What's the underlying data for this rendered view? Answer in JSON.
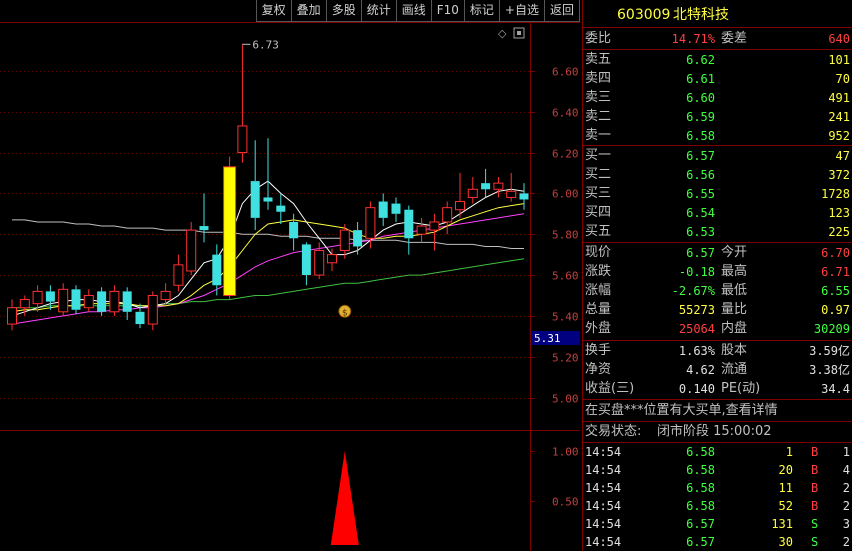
{
  "toolbar": {
    "buttons": [
      "复权",
      "叠加",
      "多股",
      "统计",
      "画线",
      "F10",
      "标记",
      "+自选",
      "返回"
    ]
  },
  "chart": {
    "high_marker": "6.73",
    "price_axis_labels": [
      "6.60",
      "6.40",
      "6.20",
      "6.00",
      "5.80",
      "5.60",
      "5.40",
      "5.20",
      "5.00"
    ],
    "current_price_tag": "5.31",
    "volume_axis_labels": [
      "1.00",
      "0.50"
    ],
    "colors": {
      "up": "#ff3030",
      "down": "#40e0e0",
      "ma5": "#ffffff",
      "ma10": "#ffff40",
      "ma20": "#ff40ff",
      "ma60": "#40c040",
      "long": "#c0c0c0"
    }
  },
  "chart_data": {
    "type": "candlestick",
    "ylim": [
      4.9,
      6.8
    ],
    "yticks": [
      5.0,
      5.2,
      5.4,
      5.6,
      5.8,
      6.0,
      6.2,
      6.4,
      6.6
    ],
    "candles": [
      {
        "o": 5.36,
        "c": 5.44,
        "h": 5.48,
        "l": 5.33
      },
      {
        "o": 5.44,
        "c": 5.48,
        "h": 5.5,
        "l": 5.4
      },
      {
        "o": 5.46,
        "c": 5.52,
        "h": 5.55,
        "l": 5.42
      },
      {
        "o": 5.52,
        "c": 5.47,
        "h": 5.55,
        "l": 5.43
      },
      {
        "o": 5.42,
        "c": 5.53,
        "h": 5.56,
        "l": 5.4
      },
      {
        "o": 5.53,
        "c": 5.43,
        "h": 5.55,
        "l": 5.41
      },
      {
        "o": 5.44,
        "c": 5.5,
        "h": 5.53,
        "l": 5.42
      },
      {
        "o": 5.52,
        "c": 5.42,
        "h": 5.54,
        "l": 5.4
      },
      {
        "o": 5.42,
        "c": 5.52,
        "h": 5.55,
        "l": 5.4
      },
      {
        "o": 5.52,
        "c": 5.42,
        "h": 5.54,
        "l": 5.38
      },
      {
        "o": 5.42,
        "c": 5.36,
        "h": 5.46,
        "l": 5.34
      },
      {
        "o": 5.36,
        "c": 5.5,
        "h": 5.52,
        "l": 5.33
      },
      {
        "o": 5.48,
        "c": 5.52,
        "h": 5.56,
        "l": 5.45
      },
      {
        "o": 5.55,
        "c": 5.65,
        "h": 5.7,
        "l": 5.52
      },
      {
        "o": 5.62,
        "c": 5.82,
        "h": 5.86,
        "l": 5.6
      },
      {
        "o": 5.84,
        "c": 5.82,
        "h": 6.0,
        "l": 5.76
      },
      {
        "o": 5.7,
        "c": 5.55,
        "h": 5.75,
        "l": 5.5
      },
      {
        "o": 5.5,
        "c": 6.13,
        "h": 6.18,
        "l": 5.48
      },
      {
        "o": 6.2,
        "c": 6.33,
        "h": 6.73,
        "l": 6.15
      },
      {
        "o": 6.06,
        "c": 5.88,
        "h": 6.26,
        "l": 5.82
      },
      {
        "o": 5.98,
        "c": 5.96,
        "h": 6.27,
        "l": 5.92
      },
      {
        "o": 5.94,
        "c": 5.91,
        "h": 6.0,
        "l": 5.85
      },
      {
        "o": 5.86,
        "c": 5.78,
        "h": 5.9,
        "l": 5.72
      },
      {
        "o": 5.75,
        "c": 5.6,
        "h": 5.76,
        "l": 5.55
      },
      {
        "o": 5.6,
        "c": 5.72,
        "h": 5.76,
        "l": 5.58
      },
      {
        "o": 5.66,
        "c": 5.7,
        "h": 5.73,
        "l": 5.62
      },
      {
        "o": 5.72,
        "c": 5.82,
        "h": 5.85,
        "l": 5.68
      },
      {
        "o": 5.82,
        "c": 5.74,
        "h": 5.86,
        "l": 5.7
      },
      {
        "o": 5.78,
        "c": 5.93,
        "h": 5.96,
        "l": 5.73
      },
      {
        "o": 5.96,
        "c": 5.88,
        "h": 6.0,
        "l": 5.84
      },
      {
        "o": 5.95,
        "c": 5.9,
        "h": 5.98,
        "l": 5.86
      },
      {
        "o": 5.92,
        "c": 5.78,
        "h": 5.94,
        "l": 5.7
      },
      {
        "o": 5.8,
        "c": 5.84,
        "h": 5.88,
        "l": 5.76
      },
      {
        "o": 5.82,
        "c": 5.86,
        "h": 5.9,
        "l": 5.72
      },
      {
        "o": 5.86,
        "c": 5.93,
        "h": 5.96,
        "l": 5.8
      },
      {
        "o": 5.92,
        "c": 5.96,
        "h": 6.1,
        "l": 5.88
      },
      {
        "o": 5.98,
        "c": 6.02,
        "h": 6.08,
        "l": 5.95
      },
      {
        "o": 6.05,
        "c": 6.02,
        "h": 6.12,
        "l": 5.98
      },
      {
        "o": 6.02,
        "c": 6.05,
        "h": 6.08,
        "l": 5.98
      },
      {
        "o": 5.98,
        "c": 6.01,
        "h": 6.1,
        "l": 5.96
      },
      {
        "o": 6.0,
        "c": 5.97,
        "h": 6.05,
        "l": 5.92
      }
    ],
    "ma5": [
      5.4,
      5.42,
      5.44,
      5.46,
      5.47,
      5.48,
      5.48,
      5.47,
      5.47,
      5.46,
      5.44,
      5.45,
      5.46,
      5.5,
      5.58,
      5.66,
      5.68,
      5.78,
      5.95,
      6.02,
      6.06,
      6.0,
      5.95,
      5.86,
      5.78,
      5.7,
      5.7,
      5.72,
      5.77,
      5.82,
      5.85,
      5.86,
      5.85,
      5.84,
      5.86,
      5.9,
      5.94,
      5.98,
      6.01,
      6.02,
      6.01
    ],
    "ma10": [
      5.42,
      5.43,
      5.43,
      5.44,
      5.45,
      5.45,
      5.46,
      5.46,
      5.46,
      5.46,
      5.45,
      5.45,
      5.45,
      5.46,
      5.5,
      5.55,
      5.58,
      5.64,
      5.72,
      5.8,
      5.85,
      5.86,
      5.87,
      5.86,
      5.85,
      5.84,
      5.83,
      5.8,
      5.78,
      5.78,
      5.79,
      5.79,
      5.8,
      5.81,
      5.84,
      5.87,
      5.89,
      5.91,
      5.93,
      5.94,
      5.95
    ],
    "ma20": [
      5.36,
      5.37,
      5.38,
      5.39,
      5.4,
      5.41,
      5.42,
      5.42,
      5.43,
      5.43,
      5.44,
      5.44,
      5.45,
      5.46,
      5.48,
      5.5,
      5.53,
      5.56,
      5.6,
      5.64,
      5.67,
      5.69,
      5.71,
      5.72,
      5.73,
      5.74,
      5.75,
      5.76,
      5.77,
      5.79,
      5.8,
      5.81,
      5.82,
      5.83,
      5.84,
      5.85,
      5.86,
      5.87,
      5.88,
      5.89,
      5.9
    ],
    "ma60": [
      5.44,
      5.44,
      5.44,
      5.45,
      5.45,
      5.45,
      5.45,
      5.45,
      5.45,
      5.45,
      5.45,
      5.45,
      5.46,
      5.46,
      5.47,
      5.47,
      5.48,
      5.48,
      5.49,
      5.5,
      5.5,
      5.51,
      5.52,
      5.53,
      5.54,
      5.55,
      5.56,
      5.56,
      5.57,
      5.58,
      5.59,
      5.6,
      5.6,
      5.61,
      5.62,
      5.63,
      5.64,
      5.65,
      5.66,
      5.67,
      5.68
    ],
    "long": [
      5.87,
      5.87,
      5.86,
      5.86,
      5.86,
      5.85,
      5.85,
      5.84,
      5.84,
      5.83,
      5.83,
      5.83,
      5.82,
      5.82,
      5.82,
      5.81,
      5.81,
      5.81,
      5.8,
      5.8,
      5.8,
      5.79,
      5.79,
      5.79,
      5.78,
      5.78,
      5.78,
      5.77,
      5.77,
      5.77,
      5.77,
      5.76,
      5.76,
      5.76,
      5.75,
      5.75,
      5.75,
      5.74,
      5.74,
      5.73,
      5.73
    ],
    "highlight_index": 17,
    "volume_ylim": [
      0,
      1.15
    ],
    "signal_index": 23,
    "signal_value": 1.0
  },
  "quote": {
    "code": "603009",
    "name": "北特科技",
    "weibi_label": "委比",
    "weibi_value": "14.71%",
    "weicha_label": "委差",
    "weicha_value": "640",
    "asks": [
      {
        "label": "卖五",
        "price": "6.62",
        "vol": "101"
      },
      {
        "label": "卖四",
        "price": "6.61",
        "vol": "70"
      },
      {
        "label": "卖三",
        "price": "6.60",
        "vol": "491"
      },
      {
        "label": "卖二",
        "price": "6.59",
        "vol": "241"
      },
      {
        "label": "卖一",
        "price": "6.58",
        "vol": "952"
      }
    ],
    "bids": [
      {
        "label": "买一",
        "price": "6.57",
        "vol": "47"
      },
      {
        "label": "买二",
        "price": "6.56",
        "vol": "372"
      },
      {
        "label": "买三",
        "price": "6.55",
        "vol": "1728"
      },
      {
        "label": "买四",
        "price": "6.54",
        "vol": "123"
      },
      {
        "label": "买五",
        "price": "6.53",
        "vol": "225"
      }
    ],
    "stats1": [
      {
        "l1": "现价",
        "v1": "6.57",
        "c1": "green",
        "l2": "今开",
        "v2": "6.70",
        "c2": "red"
      },
      {
        "l1": "涨跌",
        "v1": "-0.18",
        "c1": "green",
        "l2": "最高",
        "v2": "6.71",
        "c2": "red"
      },
      {
        "l1": "涨幅",
        "v1": "-2.67%",
        "c1": "green",
        "l2": "最低",
        "v2": "6.55",
        "c2": "green"
      },
      {
        "l1": "总量",
        "v1": "55273",
        "c1": "yellow",
        "l2": "量比",
        "v2": "0.97",
        "c2": "yellow"
      },
      {
        "l1": "外盘",
        "v1": "25064",
        "c1": "red",
        "l2": "内盘",
        "v2": "30209",
        "c2": "green"
      }
    ],
    "stats2": [
      {
        "l1": "换手",
        "v1": "1.63%",
        "l2": "股本",
        "v2": "3.59亿"
      },
      {
        "l1": "净资",
        "v1": "4.62",
        "l2": "流通",
        "v2": "3.38亿"
      },
      {
        "l1": "收益(三)",
        "v1": "0.140",
        "l2": "PE(动)",
        "v2": "34.4"
      }
    ],
    "notice": "在买盘***位置有大买单,查看详情",
    "trade_status_label": "交易状态:",
    "trade_status_value": "闭市阶段 15:00:02",
    "ticks": [
      {
        "time": "14:54",
        "price": "6.58",
        "vol": "1",
        "side": "B",
        "n": "1"
      },
      {
        "time": "14:54",
        "price": "6.58",
        "vol": "20",
        "side": "B",
        "n": "4"
      },
      {
        "time": "14:54",
        "price": "6.58",
        "vol": "11",
        "side": "B",
        "n": "2"
      },
      {
        "time": "14:54",
        "price": "6.58",
        "vol": "52",
        "side": "B",
        "n": "2"
      },
      {
        "time": "14:54",
        "price": "6.57",
        "vol": "131",
        "side": "S",
        "n": "3"
      },
      {
        "time": "14:54",
        "price": "6.57",
        "vol": "30",
        "side": "S",
        "n": "2"
      }
    ]
  }
}
